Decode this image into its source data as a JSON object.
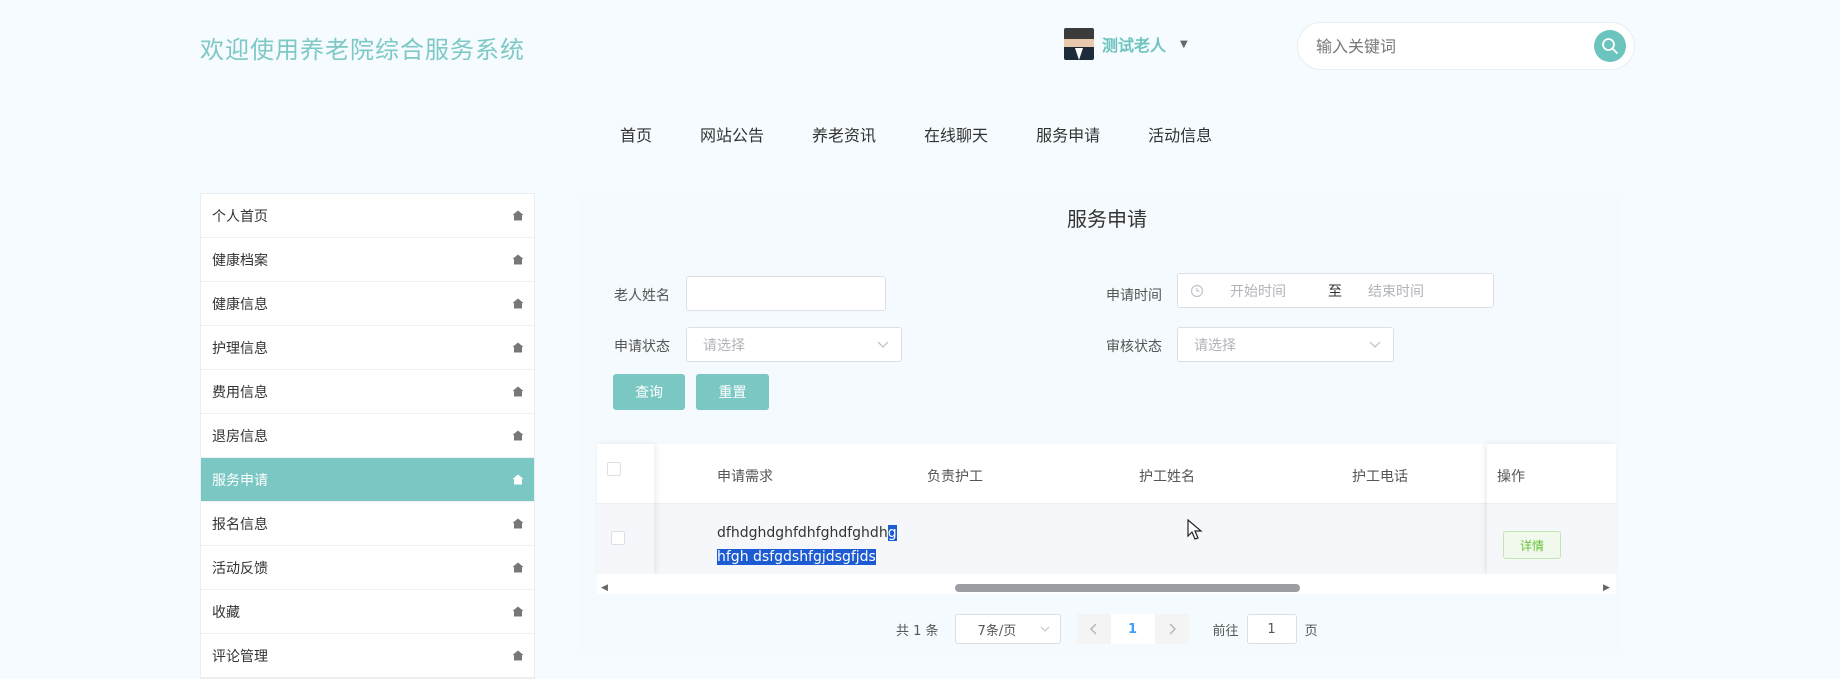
{
  "header": {
    "title": "欢迎使用养老院综合服务系统",
    "user_name": "测试老人",
    "search_placeholder": "输入关键词"
  },
  "nav": [
    "首页",
    "网站公告",
    "养老资讯",
    "在线聊天",
    "服务申请",
    "活动信息"
  ],
  "sidebar": {
    "items": [
      {
        "label": "个人首页",
        "active": false
      },
      {
        "label": "健康档案",
        "active": false
      },
      {
        "label": "健康信息",
        "active": false
      },
      {
        "label": "护理信息",
        "active": false
      },
      {
        "label": "费用信息",
        "active": false
      },
      {
        "label": "退房信息",
        "active": false
      },
      {
        "label": "服务申请",
        "active": true
      },
      {
        "label": "报名信息",
        "active": false
      },
      {
        "label": "活动反馈",
        "active": false
      },
      {
        "label": "收藏",
        "active": false
      },
      {
        "label": "评论管理",
        "active": false
      }
    ]
  },
  "main": {
    "title": "服务申请",
    "filters": {
      "elder_name_label": "老人姓名",
      "elder_name_value": "",
      "apply_time_label": "申请时间",
      "start_placeholder": "开始时间",
      "range_sep": "至",
      "end_placeholder": "结束时间",
      "apply_status_label": "申请状态",
      "apply_status_placeholder": "请选择",
      "review_status_label": "审核状态",
      "review_status_placeholder": "请选择"
    },
    "buttons": {
      "query": "查询",
      "reset": "重置"
    },
    "table": {
      "columns": [
        "申请需求",
        "负责护工",
        "护工姓名",
        "护工电话",
        "操作"
      ],
      "rows": [
        {
          "request_line1_plain": "dfhdghdghfdhfghdfghdh",
          "request_line1_sel": "g",
          "request_line2_sel": "hfgh dsfgdshfgjdsgfjds",
          "caretaker": "",
          "caretaker_name": "",
          "caretaker_phone": "",
          "action": "详情"
        }
      ]
    },
    "pagination": {
      "total": "共 1 条",
      "page_size": "7条/页",
      "current": "1",
      "goto_label": "前往",
      "goto_value": "1",
      "page_unit": "页"
    }
  },
  "colors": {
    "accent": "#7ac7c3",
    "title": "#7ec9c5",
    "selection": "#1c5bd1"
  },
  "icons": {
    "search": "search-icon",
    "home": "home-icon",
    "clock": "clock-icon",
    "chevron": "chevron-down-icon"
  }
}
